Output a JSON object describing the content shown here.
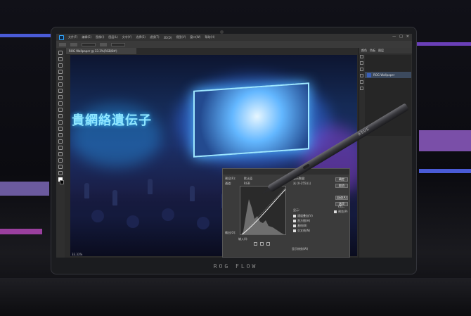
{
  "photoshop": {
    "menu_items": [
      "文件(F)",
      "编辑(E)",
      "图像(I)",
      "图层(L)",
      "文字(Y)",
      "选择(S)",
      "滤镜(T)",
      "3D(D)",
      "视图(V)",
      "窗口(W)",
      "帮助(H)"
    ],
    "window_controls": [
      "—",
      "□",
      "×"
    ],
    "document_tab": "ROG Wallpaper @ 33.3%(RGB/8#)",
    "status_text": "33.33%",
    "panel_tabs": [
      "颜色",
      "色板",
      "图层"
    ],
    "layer_name": "ROG Wallpaper"
  },
  "curves": {
    "preset_label": "预设(R):",
    "preset_value": "默认值",
    "channel_label": "通道:",
    "channel_value": "RGB",
    "display_amount_label": "显示数量:",
    "light_option": "光 (0-255)(L)",
    "output_label": "输出(O):",
    "input_label": "输入(I):",
    "show_label": "显示:",
    "checks": [
      "通道叠加(V)",
      "直方图(H)",
      "基线(B)",
      "交叉线(N)"
    ],
    "buttons": [
      "确定",
      "取消",
      "自动(A)",
      "选项(T)..."
    ],
    "preview_label": "预览(P)",
    "show_clipping": "显示修剪(W)"
  },
  "laptop": {
    "bezel_logo": "ROG FLOW",
    "stylus_brand": "ASUS"
  },
  "canvas": {
    "neon_sign": "貴網絡遺伝子"
  }
}
